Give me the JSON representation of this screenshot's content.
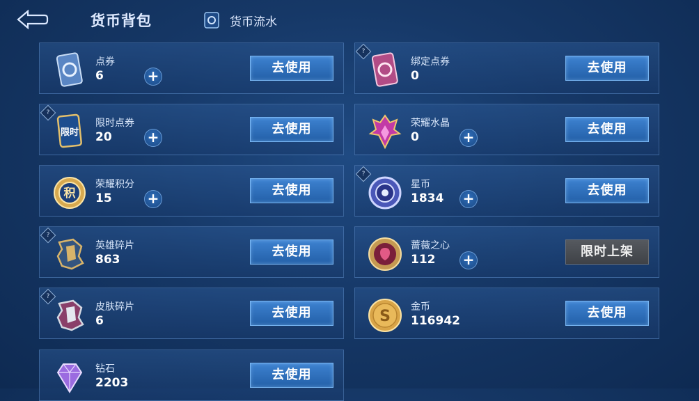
{
  "header": {
    "title": "货币背包",
    "flow_label": "货币流水"
  },
  "cards": [
    {
      "name": "点券",
      "value": "6",
      "action": "去使用"
    },
    {
      "name": "绑定点券",
      "value": "0",
      "action": "去使用"
    },
    {
      "name": "限时点券",
      "value": "20",
      "action": "去使用",
      "icon_text": "限时"
    },
    {
      "name": "荣耀水晶",
      "value": "0",
      "action": "去使用"
    },
    {
      "name": "荣耀积分",
      "value": "15",
      "action": "去使用",
      "icon_text": "积"
    },
    {
      "name": "星币",
      "value": "1834",
      "action": "去使用"
    },
    {
      "name": "英雄碎片",
      "value": "863",
      "action": "去使用"
    },
    {
      "name": "蔷薇之心",
      "value": "112",
      "action": "限时上架"
    },
    {
      "name": "皮肤碎片",
      "value": "6",
      "action": "去使用"
    },
    {
      "name": "金币",
      "value": "116942",
      "action": "去使用",
      "icon_text": "S"
    },
    {
      "name": "钻石",
      "value": "2203",
      "action": "去使用"
    }
  ],
  "help_badge": "?",
  "plus_symbol": "+",
  "colors": {
    "background": "#163867",
    "button_blue": "#2f72c0",
    "button_disabled": "#4a4d52",
    "gold": "#d9b062"
  }
}
